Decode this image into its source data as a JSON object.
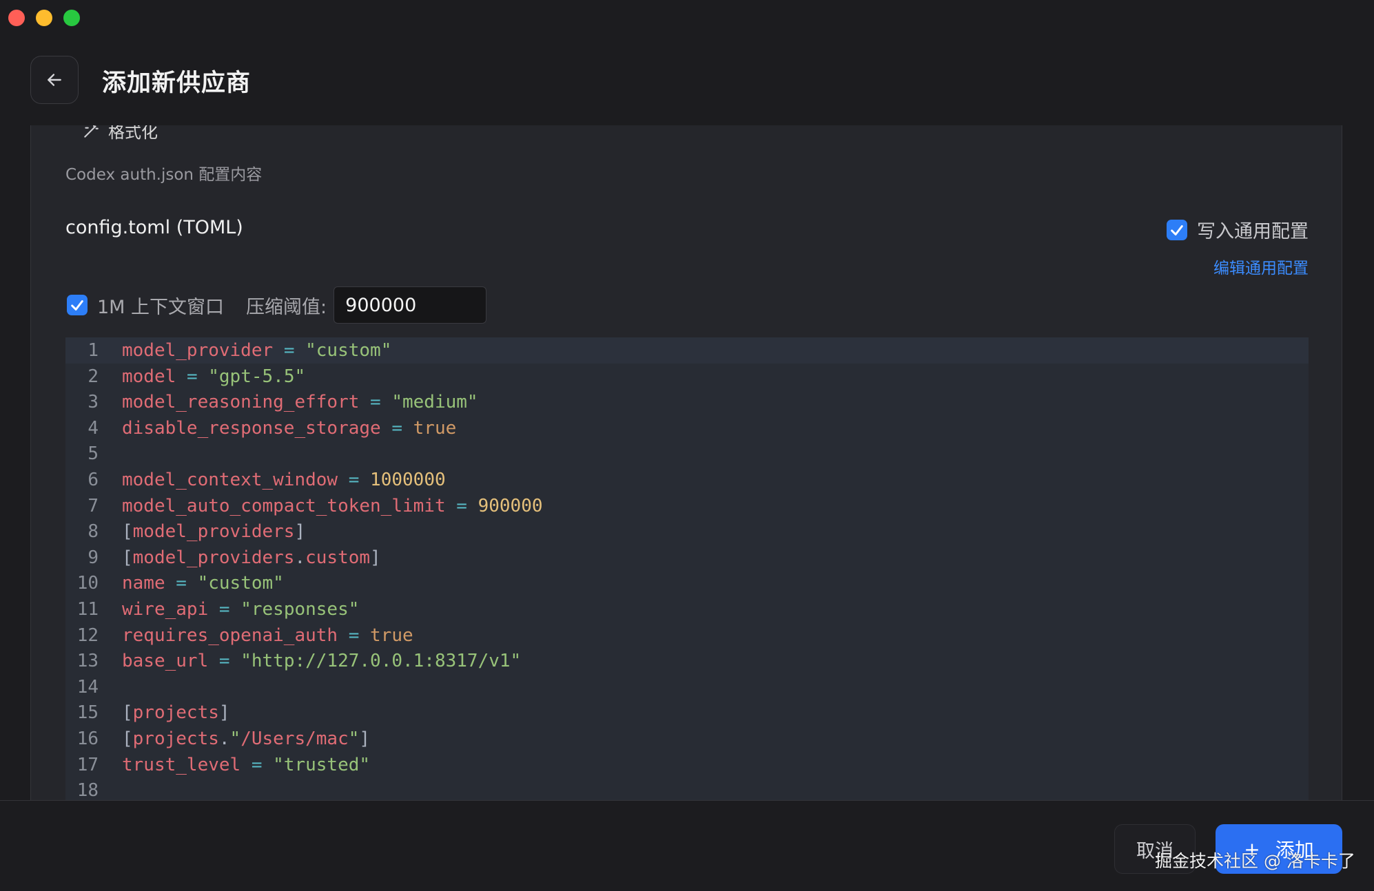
{
  "header": {
    "title": "添加新供应商"
  },
  "panel": {
    "format_label": "格式化",
    "auth_description": "Codex auth.json 配置内容",
    "config_title": "config.toml (TOML)",
    "write_common_label": "写入通用配置",
    "write_common_checked": true,
    "edit_common_link": "编辑通用配置",
    "context_window_label": "1M 上下文窗口",
    "context_window_checked": true,
    "threshold_label": "压缩阈值:",
    "threshold_value": "900000"
  },
  "editor": {
    "lines": [
      {
        "n": "1",
        "t": [
          [
            "k",
            "model_provider"
          ],
          [
            "p",
            " "
          ],
          [
            "o",
            "="
          ],
          [
            "p",
            " "
          ],
          [
            "s",
            "\"custom\""
          ]
        ]
      },
      {
        "n": "2",
        "t": [
          [
            "k",
            "model"
          ],
          [
            "p",
            " "
          ],
          [
            "o",
            "="
          ],
          [
            "p",
            " "
          ],
          [
            "s",
            "\"gpt-5.5\""
          ]
        ]
      },
      {
        "n": "3",
        "t": [
          [
            "k",
            "model_reasoning_effort"
          ],
          [
            "p",
            " "
          ],
          [
            "o",
            "="
          ],
          [
            "p",
            " "
          ],
          [
            "s",
            "\"medium\""
          ]
        ]
      },
      {
        "n": "4",
        "t": [
          [
            "k",
            "disable_response_storage"
          ],
          [
            "p",
            " "
          ],
          [
            "o",
            "="
          ],
          [
            "p",
            " "
          ],
          [
            "b",
            "true"
          ]
        ]
      },
      {
        "n": "5",
        "t": []
      },
      {
        "n": "6",
        "t": [
          [
            "k",
            "model_context_window"
          ],
          [
            "p",
            " "
          ],
          [
            "o",
            "="
          ],
          [
            "p",
            " "
          ],
          [
            "n",
            "1000000"
          ]
        ]
      },
      {
        "n": "7",
        "t": [
          [
            "k",
            "model_auto_compact_token_limit"
          ],
          [
            "p",
            " "
          ],
          [
            "o",
            "="
          ],
          [
            "p",
            " "
          ],
          [
            "n",
            "900000"
          ]
        ]
      },
      {
        "n": "8",
        "t": [
          [
            "p",
            "["
          ],
          [
            "k",
            "model_providers"
          ],
          [
            "p",
            "]"
          ]
        ]
      },
      {
        "n": "9",
        "t": [
          [
            "p",
            "["
          ],
          [
            "k",
            "model_providers"
          ],
          [
            "p",
            "."
          ],
          [
            "k",
            "custom"
          ],
          [
            "p",
            "]"
          ]
        ]
      },
      {
        "n": "10",
        "t": [
          [
            "k",
            "name"
          ],
          [
            "p",
            " "
          ],
          [
            "o",
            "="
          ],
          [
            "p",
            " "
          ],
          [
            "s",
            "\"custom\""
          ]
        ]
      },
      {
        "n": "11",
        "t": [
          [
            "k",
            "wire_api"
          ],
          [
            "p",
            " "
          ],
          [
            "o",
            "="
          ],
          [
            "p",
            " "
          ],
          [
            "s",
            "\"responses\""
          ]
        ]
      },
      {
        "n": "12",
        "t": [
          [
            "k",
            "requires_openai_auth"
          ],
          [
            "p",
            " "
          ],
          [
            "o",
            "="
          ],
          [
            "p",
            " "
          ],
          [
            "b",
            "true"
          ]
        ]
      },
      {
        "n": "13",
        "t": [
          [
            "k",
            "base_url"
          ],
          [
            "p",
            " "
          ],
          [
            "o",
            "="
          ],
          [
            "p",
            " "
          ],
          [
            "s",
            "\"http://127.0.0.1:8317/v1\""
          ]
        ]
      },
      {
        "n": "14",
        "t": []
      },
      {
        "n": "15",
        "t": [
          [
            "p",
            "["
          ],
          [
            "k",
            "projects"
          ],
          [
            "p",
            "]"
          ]
        ]
      },
      {
        "n": "16",
        "t": [
          [
            "p",
            "["
          ],
          [
            "k",
            "projects"
          ],
          [
            "p",
            "."
          ],
          [
            "s",
            "\""
          ],
          [
            "k",
            "/Users/mac"
          ],
          [
            "s",
            "\""
          ],
          [
            "p",
            "]"
          ]
        ]
      },
      {
        "n": "17",
        "t": [
          [
            "k",
            "trust_level"
          ],
          [
            "p",
            " "
          ],
          [
            "o",
            "="
          ],
          [
            "p",
            " "
          ],
          [
            "s",
            "\"trusted\""
          ]
        ]
      },
      {
        "n": "18",
        "t": []
      }
    ]
  },
  "footer": {
    "cancel_label": "取消",
    "add_icon": "+",
    "add_label": "添加",
    "watermark": "掘金技术社区 @ 洛卡卡了"
  },
  "colors": {
    "accent": "#2b6ff2",
    "link": "#3b8cff",
    "checkbox": "#2d7ef7"
  }
}
